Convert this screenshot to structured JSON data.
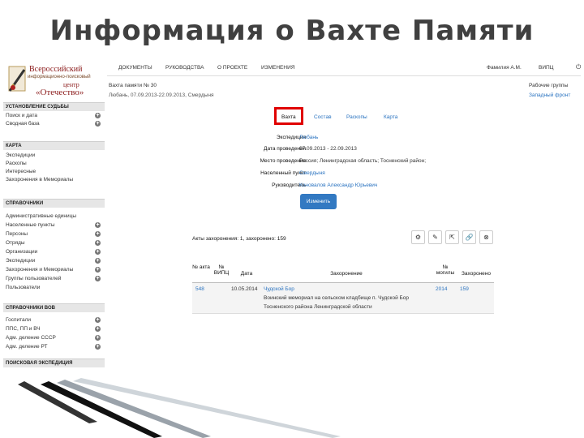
{
  "slide_title": "Информация о Вахте Памяти",
  "logo": {
    "line1": "Всероссийский",
    "line2": "информационно-поисковый",
    "line3": "центр",
    "line4": "«Отечество»"
  },
  "sidebar": {
    "sections": [
      {
        "title": "УСТАНОВЛЕНИЕ СУДЬБЫ",
        "items": [
          "Поиск и дата",
          "Сводная база"
        ]
      },
      {
        "title": "КАРТА",
        "items": [
          "Экспедиции",
          "Раскопы",
          "Интересные",
          "Захоронения в Мемориалы"
        ]
      },
      {
        "title": "СПРАВОЧНИКИ",
        "items": [
          "Административные единицы",
          "Населенные пункты",
          "Персоны",
          "Отряды",
          "Организации",
          "Экспедиции",
          "Захоронения и Мемориалы",
          "Группы пользователей",
          "Пользователи"
        ]
      },
      {
        "title": "СПРАВОЧНИКИ ВОВ",
        "items": [
          "Госпитали",
          "ППС, ПП и ВЧ",
          "Адм. деление СССР",
          "Адм. деление РТ"
        ]
      },
      {
        "title": "ПОИСКОВАЯ ЭКСПЕДИЦИЯ",
        "items": []
      }
    ]
  },
  "topnav": {
    "items": [
      "ДОКУМЕНТЫ",
      "РУКОВОДСТВА",
      "О ПРОЕКТЕ",
      "ИЗМЕНЕНИЯ"
    ],
    "user": "Фамилия А.М.",
    "org": "ВИПЦ",
    "power_icon": "⏻"
  },
  "vakhta": {
    "header": "Вахта памяти № 30",
    "subheader": "Любань, 07.09.2013-22.09.2013, Смердыня",
    "right_top": "Рабочие группы",
    "right_link": "Западный фронт"
  },
  "tabs": {
    "active": "Вахта",
    "others": [
      "Состав",
      "Раскопы",
      "Карта"
    ]
  },
  "details": [
    {
      "label": "Экспедиция",
      "value": "Любань",
      "link": true
    },
    {
      "label": "Дата проведения",
      "value": "07.09.2013 - 22.09.2013",
      "link": false
    },
    {
      "label": "Место проведения",
      "value": "Россия; Ленинградская область; Тосненский район;",
      "link": false
    },
    {
      "label": "Населенный пункт",
      "value": "Смердыня",
      "link": true
    },
    {
      "label": "Руководитель",
      "value": "Коновалов Александр Юрьевич",
      "link": true
    }
  ],
  "edit_button": "Изменить",
  "acts": {
    "summary": "Акты захоронения: 1, захоронено: 159",
    "columns": [
      "№ акта",
      "№ ВИПЦ",
      "Дата",
      "Захоронение",
      "№ могилы",
      "Захоронено"
    ],
    "rows": [
      {
        "act": "548",
        "vipc": "",
        "date": "10.05.2014",
        "burial_link": "Чудской Бор",
        "burial_text1": "Воинский мемориал на сельском кладбище п. Чудской Бор",
        "burial_text2": "Тосненского района Ленинградской области",
        "grave": "2014",
        "buried": "159"
      }
    ]
  },
  "colors": {
    "accent": "#3279c2",
    "link": "#2a73c0",
    "highlight": "#e00000",
    "brand": "#8b1a1a"
  }
}
